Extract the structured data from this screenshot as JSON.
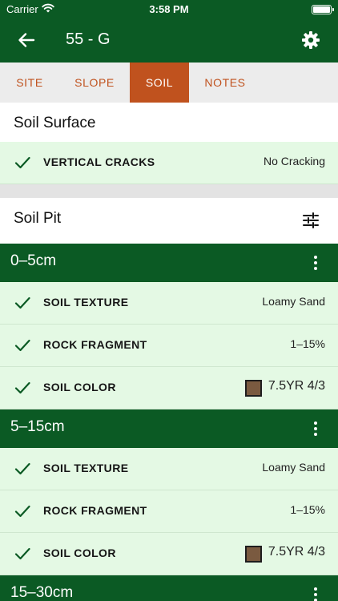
{
  "status_bar": {
    "carrier": "Carrier",
    "time": "3:58 PM"
  },
  "nav": {
    "title": "55 - G",
    "back_icon": "arrow-left-icon",
    "settings_icon": "gear-icon"
  },
  "tabs": [
    {
      "label": "SITE",
      "active": false
    },
    {
      "label": "SLOPE",
      "active": false
    },
    {
      "label": "SOIL",
      "active": true
    },
    {
      "label": "NOTES",
      "active": false
    }
  ],
  "soil_surface": {
    "title": "Soil Surface",
    "rows": [
      {
        "name": "VERTICAL CRACKS",
        "value": "No Cracking"
      }
    ]
  },
  "soil_pit": {
    "title": "Soil Pit",
    "filter_icon": "sliders-icon",
    "layers": [
      {
        "depth": "0–5cm",
        "rows": [
          {
            "name": "SOIL TEXTURE",
            "value": "Loamy Sand"
          },
          {
            "name": "ROCK FRAGMENT",
            "value": "1–15%"
          },
          {
            "name": "SOIL COLOR",
            "value": "7.5YR 4/3",
            "swatch": "#7a5a40"
          }
        ]
      },
      {
        "depth": "5–15cm",
        "rows": [
          {
            "name": "SOIL TEXTURE",
            "value": "Loamy Sand"
          },
          {
            "name": "ROCK FRAGMENT",
            "value": "1–15%"
          },
          {
            "name": "SOIL COLOR",
            "value": "7.5YR 4/3",
            "swatch": "#7a5a40"
          }
        ]
      },
      {
        "depth": "15–30cm",
        "rows": []
      }
    ]
  },
  "colors": {
    "primary_green": "#0b5a24",
    "accent_orange": "#c0521e",
    "row_bg": "#e4f9e4",
    "check_green": "#0b5a24"
  }
}
